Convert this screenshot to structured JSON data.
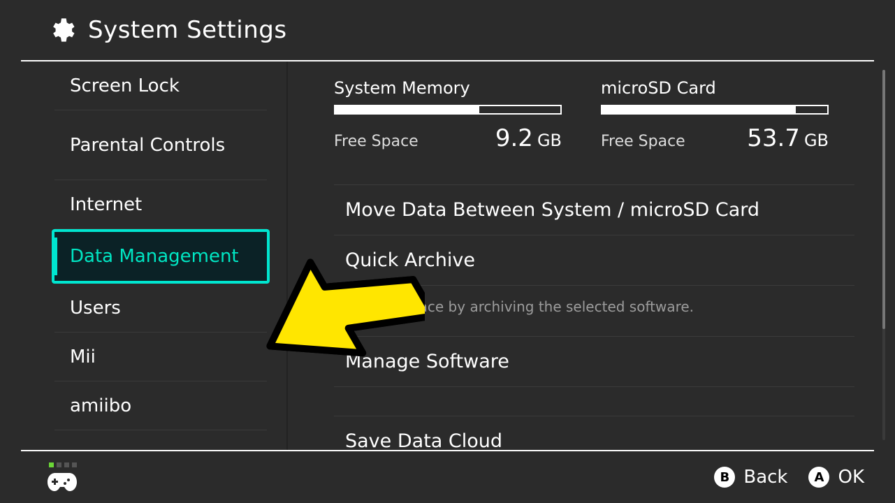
{
  "header": {
    "title": "System Settings"
  },
  "sidebar": {
    "items": [
      {
        "label": "Screen Lock"
      },
      {
        "label": "Parental Controls"
      },
      {
        "label": "Internet"
      },
      {
        "label": "Data Management",
        "selected": true
      },
      {
        "label": "Users"
      },
      {
        "label": "Mii"
      },
      {
        "label": "amiibo"
      }
    ]
  },
  "storage": {
    "system": {
      "title": "System Memory",
      "free_label": "Free Space",
      "value": "9.2",
      "unit": "GB",
      "fill_pct": 64
    },
    "sd": {
      "title": "microSD Card",
      "free_label": "Free Space",
      "value": "53.7",
      "unit": "GB",
      "fill_pct": 86
    }
  },
  "content": {
    "move_data": "Move Data Between System / microSD Card",
    "quick_archive": "Quick Archive",
    "quick_hint": "Free up space by archiving the selected software.",
    "manage_sw": "Manage Software",
    "save_cloud": "Save Data Cloud"
  },
  "footer": {
    "buttons": {
      "b": {
        "glyph": "B",
        "label": "Back"
      },
      "a": {
        "glyph": "A",
        "label": "OK"
      }
    }
  }
}
